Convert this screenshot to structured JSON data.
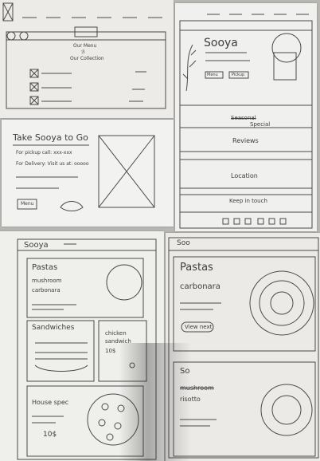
{
  "sketch1": {
    "center_text_line1": "Our Menu",
    "center_text_line2": "ℬ",
    "center_text_line3": "Our Collection"
  },
  "sketch2": {
    "title": "Sooya",
    "button_left": "Menu",
    "button_right": "Pickup",
    "nav_special_strike": "Seasonal",
    "nav_special": "Special",
    "nav_reviews": "Reviews",
    "nav_location": "Location",
    "nav_keep_in_touch": "Keep in touch"
  },
  "sketch3": {
    "title": "Take Sooya to Go",
    "line_pickup": "For pickup call: xxx-xxx",
    "line_delivery": "For Delivery: Visit us at: ooooo",
    "button": "Menu"
  },
  "sketch4": {
    "header_title": "Sooya",
    "pasta_title": "Pastas",
    "pasta_sub1": "mushroom",
    "pasta_sub2": "carbonara",
    "sandwich_title": "Sandwiches",
    "chicken_line1": "chicken",
    "chicken_line2": "sandwich",
    "chicken_price": "10$",
    "house_title": "House spec",
    "house_price": "10$"
  },
  "sketch5": {
    "header_title": "Soo",
    "pasta_title": "Pastas",
    "pasta_sub": "carbonara",
    "button": "View next",
    "card2_title": "So",
    "card2_strike": "mushroom",
    "card2_sub": "risotto"
  },
  "colors": {
    "paper": "#efefec",
    "pencil": "#3d3d3d",
    "background": "#b9b7b2"
  }
}
